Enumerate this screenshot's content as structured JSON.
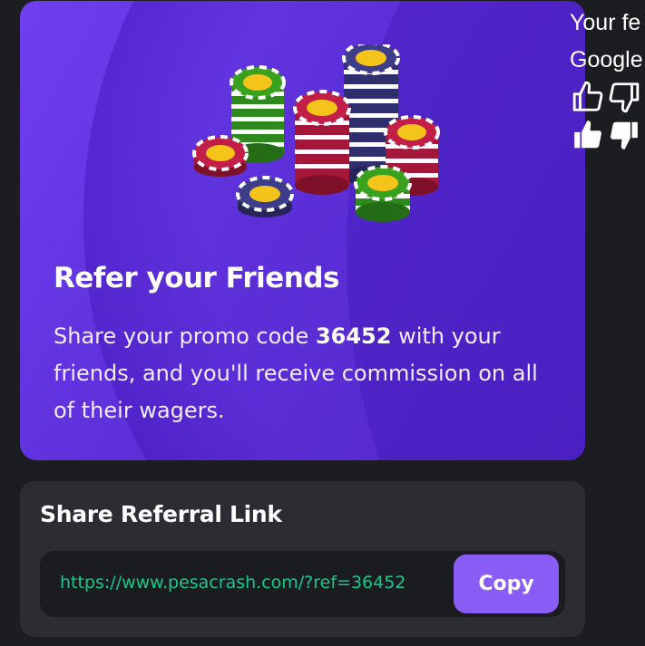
{
  "promo": {
    "title": "Refer your Friends",
    "desc_before": "Share your promo code ",
    "promo_code": "36452",
    "desc_after": " with your friends, and you'll receive commission on all of their wagers."
  },
  "referral": {
    "title": "Share Referral Link",
    "link": "https://www.pesacrash.com/?ref=36452",
    "copy_label": "Copy"
  },
  "feedback_panel": {
    "line1": "Your fe",
    "line2": "Google"
  },
  "icons": {
    "chips": "poker-chips-illustration",
    "thumbs_up_outline": "thumbs-up-outline-icon",
    "thumbs_down_outline": "thumbs-down-outline-icon",
    "thumbs_up_filled": "thumbs-up-filled-icon",
    "thumbs_down_filled": "thumbs-down-filled-icon"
  },
  "colors": {
    "accent": "#8a5cf6",
    "link": "#17c889",
    "card": "#2b2d33",
    "background": "#1c1d21"
  }
}
